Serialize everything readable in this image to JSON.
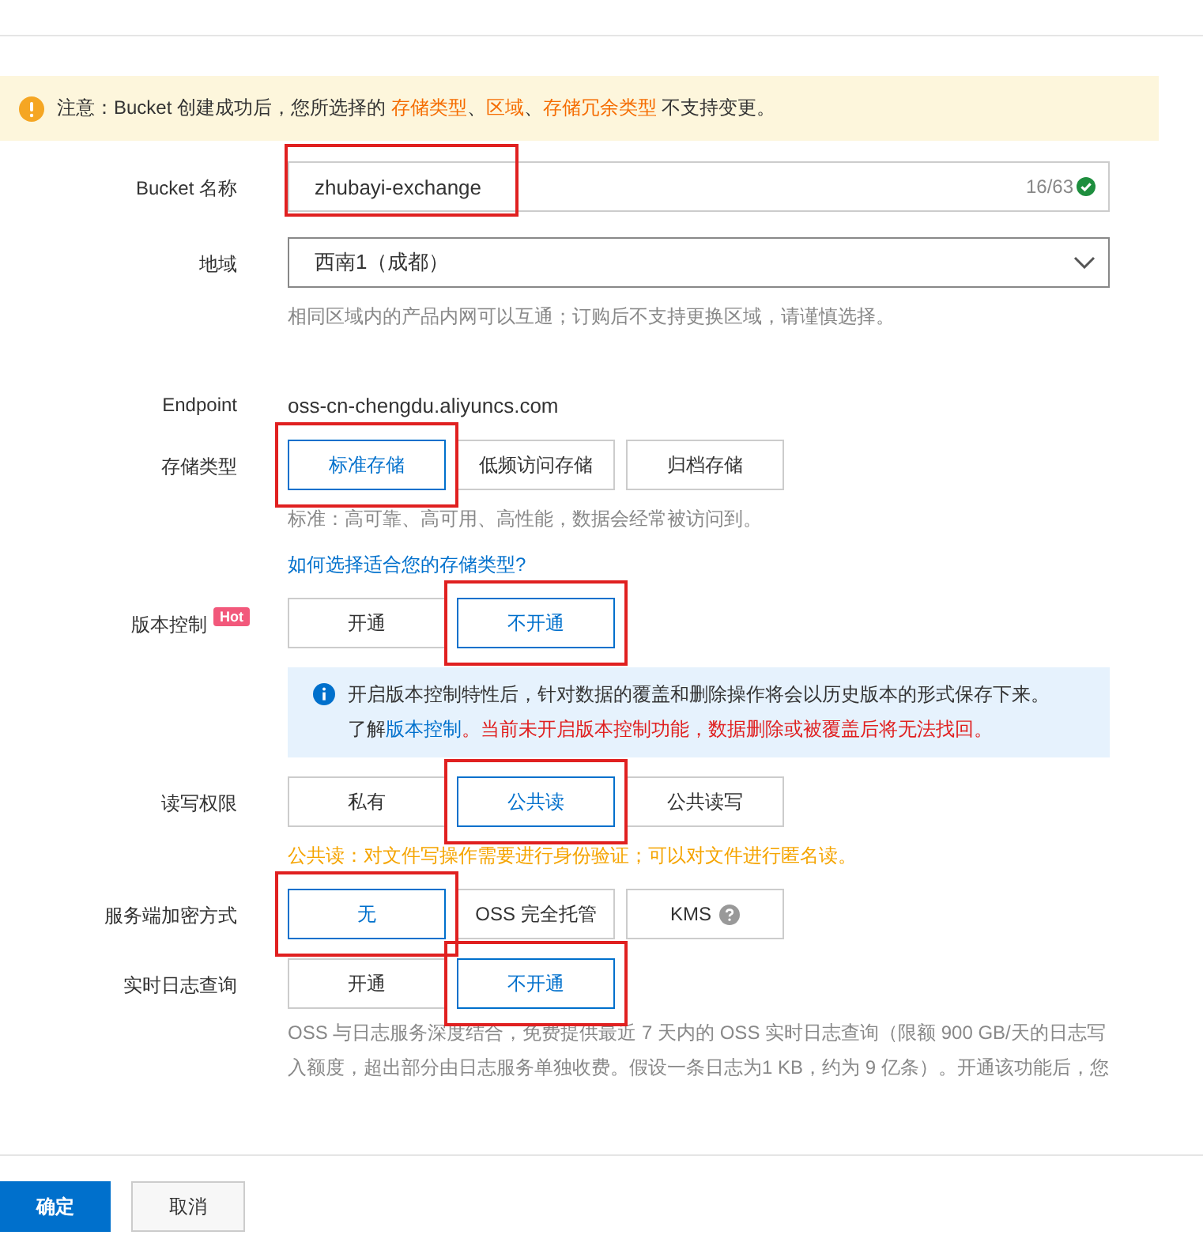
{
  "notice": {
    "parts": [
      {
        "text": "注意：Bucket 创建成功后，您所选择的 ",
        "emphasis": false
      },
      {
        "text": "存储类型",
        "emphasis": true
      },
      {
        "text": "、",
        "emphasis": false
      },
      {
        "text": "区域",
        "emphasis": true
      },
      {
        "text": "、",
        "emphasis": false
      },
      {
        "text": "存储冗余类型",
        "emphasis": true
      },
      {
        "text": " 不支持变更。",
        "emphasis": false
      }
    ]
  },
  "rows": [
    {
      "kind": "text-field",
      "label": "Bucket 名称",
      "value": "zhubayi-exchange",
      "counter": "16/63",
      "valid": true,
      "highlighted": true
    },
    {
      "kind": "select",
      "label": "地域",
      "value": "西南1（成都）",
      "help": "相同区域内的产品内网可以互通；订购后不支持更换区域，请谨慎选择。"
    },
    {
      "kind": "static",
      "label": "Endpoint",
      "value": "oss-cn-chengdu.aliyuncs.com"
    },
    {
      "kind": "options",
      "label": "存储类型",
      "options": [
        {
          "label": "标准存储",
          "selected": true,
          "highlighted": true
        },
        {
          "label": "低频访问存储",
          "selected": false
        },
        {
          "label": "归档存储",
          "selected": false
        }
      ],
      "help": "标准：高可靠、高可用、高性能，数据会经常被访问到。",
      "link": "如何选择适合您的存储类型?"
    },
    {
      "kind": "options",
      "label": "版本控制",
      "badge": "Hot",
      "options": [
        {
          "label": "开通",
          "selected": false
        },
        {
          "label": "不开通",
          "selected": true,
          "highlighted": true
        }
      ],
      "info": {
        "line1": "开启版本控制特性后，针对数据的覆盖和删除操作将会以历史版本的形式保存下来。",
        "prefix": "了解 ",
        "link": "版本控制",
        "warning": "。当前未开启版本控制功能，数据删除或被覆盖后将无法找回。"
      }
    },
    {
      "kind": "options",
      "label": "读写权限",
      "options": [
        {
          "label": "私有",
          "selected": false
        },
        {
          "label": "公共读",
          "selected": true,
          "highlighted": true
        },
        {
          "label": "公共读写",
          "selected": false
        }
      ],
      "caution": "公共读：对文件写操作需要进行身份验证；可以对文件进行匿名读。"
    },
    {
      "kind": "options",
      "label": "服务端加密方式",
      "options": [
        {
          "label": "无",
          "selected": true,
          "highlighted": true
        },
        {
          "label": "OSS 完全托管",
          "selected": false
        },
        {
          "label": "KMS",
          "selected": false,
          "help_icon": true
        }
      ]
    },
    {
      "kind": "options",
      "label": "实时日志查询",
      "options": [
        {
          "label": "开通",
          "selected": false
        },
        {
          "label": "不开通",
          "selected": true,
          "highlighted": true
        }
      ],
      "help": "OSS 与日志服务深度结合，免费提供最近 7 天内的 OSS 实时日志查询（限额 900 GB/天的日志写入额度，超出部分由日志服务单独收费。假设一条日志为1 KB，约为 9 亿条）。开通该功能后，您"
    }
  ],
  "footer": {
    "buttons": [
      {
        "label": "确定",
        "kind": "primary"
      },
      {
        "label": "取消",
        "kind": "default"
      }
    ]
  }
}
